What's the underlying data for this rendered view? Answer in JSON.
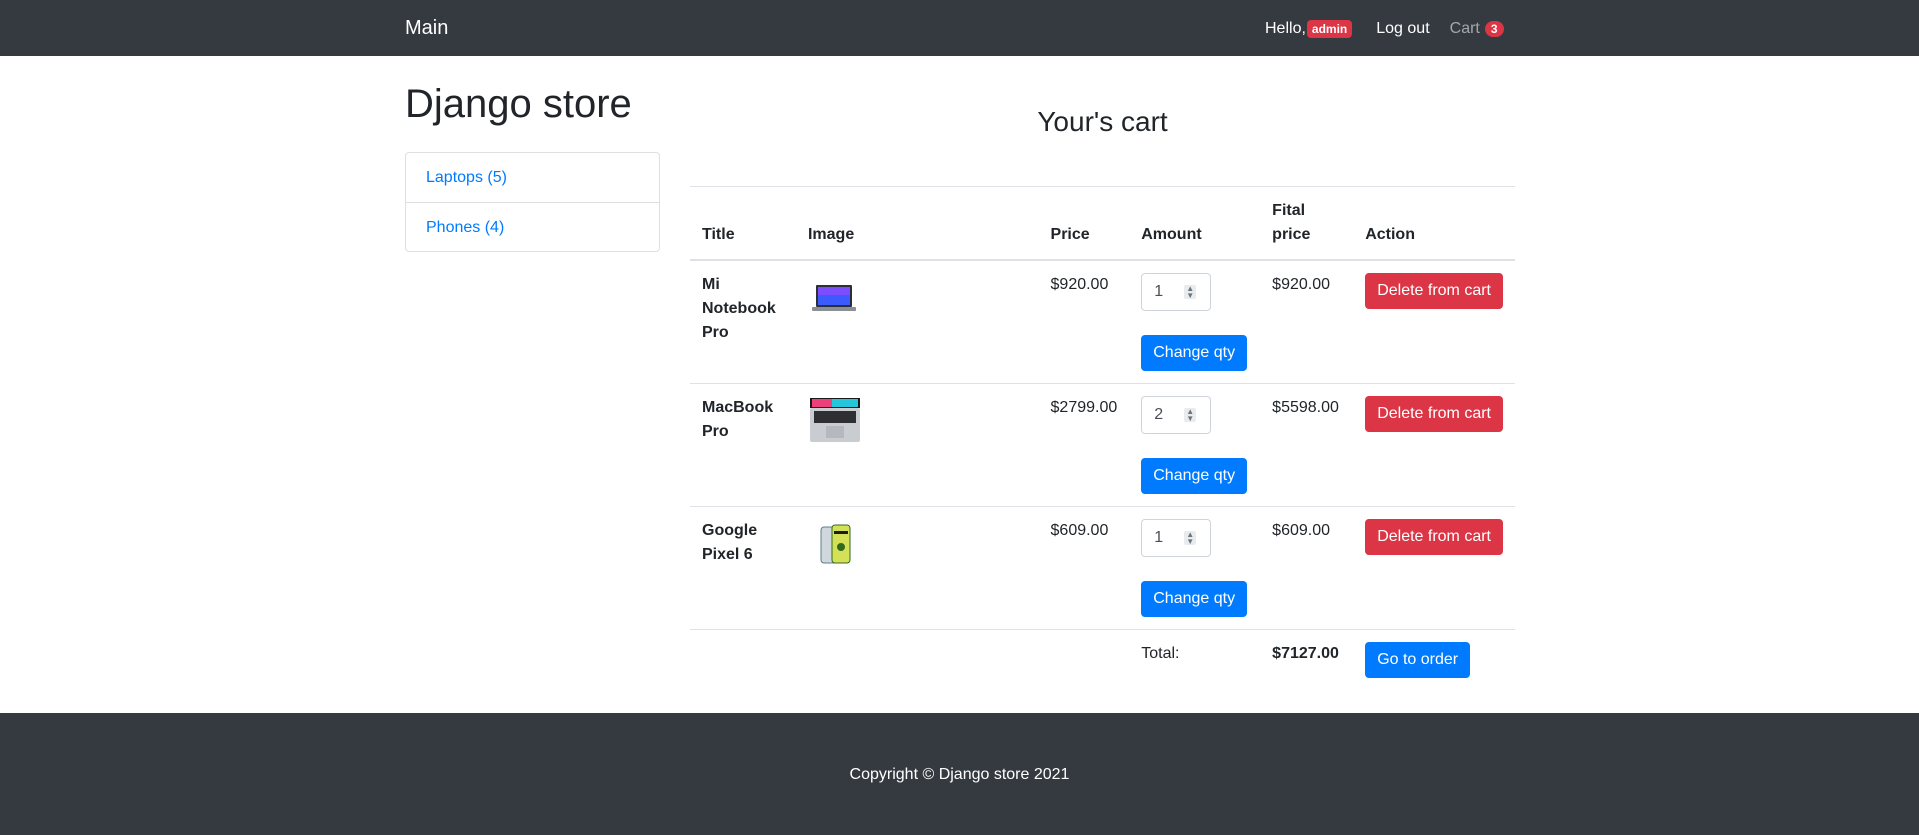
{
  "navbar": {
    "brand": "Main",
    "hello": "Hello,",
    "username": "admin",
    "logout": "Log out",
    "cart_label": "Cart",
    "cart_count": "3"
  },
  "sidebar": {
    "title": "Django store",
    "categories": [
      {
        "label": "Laptops (5)"
      },
      {
        "label": "Phones (4)"
      }
    ]
  },
  "cart": {
    "heading": "Your's cart",
    "columns": {
      "title": "Title",
      "image": "Image",
      "price": "Price",
      "amount": "Amount",
      "final_price": "Fital price",
      "action": "Action"
    },
    "items": [
      {
        "title": "Mi Notebook Pro",
        "image_icon": "laptop-thumbnail",
        "price": "$920.00",
        "qty": "1",
        "final_price": "$920.00",
        "change_label": "Change qty",
        "delete_label": "Delete from cart"
      },
      {
        "title": "MacBook Pro",
        "image_icon": "laptop-thumbnail",
        "price": "$2799.00",
        "qty": "2",
        "final_price": "$5598.00",
        "change_label": "Change qty",
        "delete_label": "Delete from cart"
      },
      {
        "title": "Google Pixel 6",
        "image_icon": "phone-thumbnail",
        "price": "$609.00",
        "qty": "1",
        "final_price": "$609.00",
        "change_label": "Change qty",
        "delete_label": "Delete from cart"
      }
    ],
    "total_label": "Total:",
    "total_value": "$7127.00",
    "order_label": "Go to order"
  },
  "footer": {
    "copyright": "Copyright © Django store 2021"
  },
  "colors": {
    "navbar_bg": "#343a40",
    "primary": "#007bff",
    "danger": "#dc3545"
  }
}
